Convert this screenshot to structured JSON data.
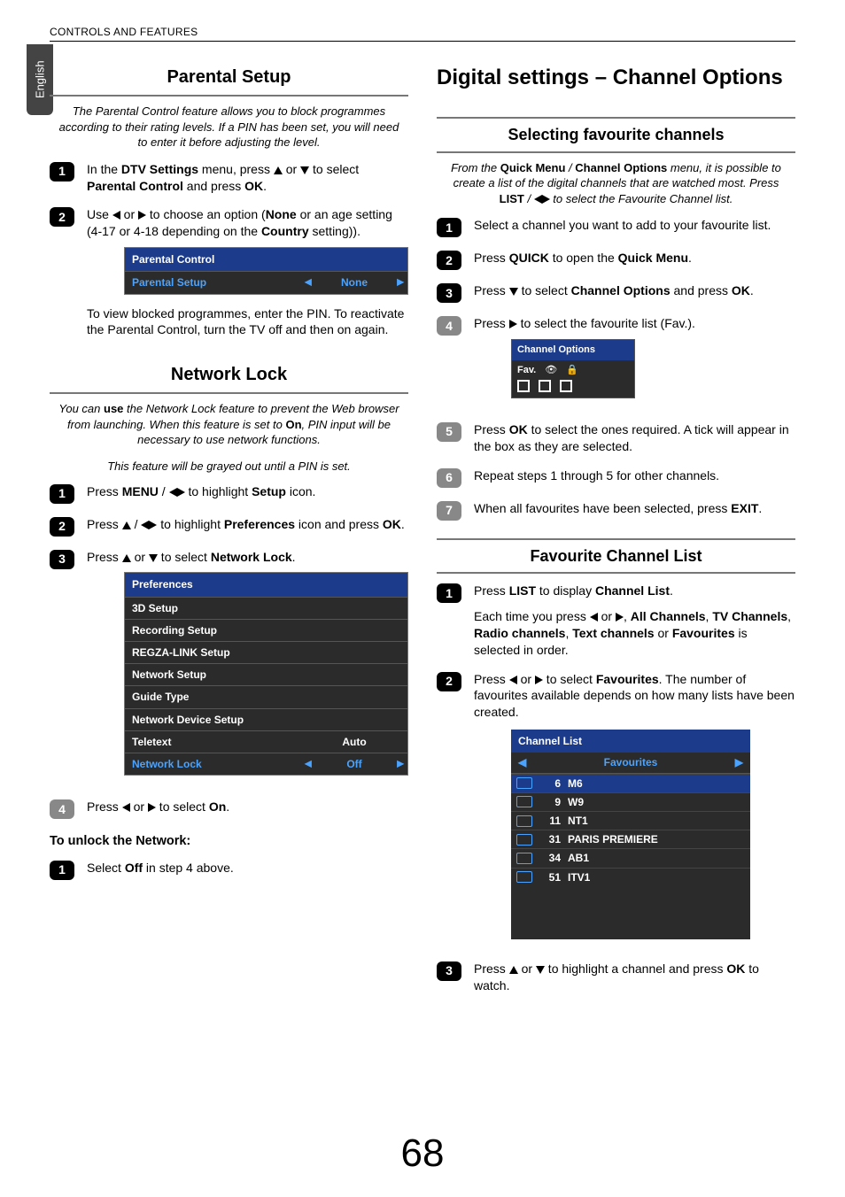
{
  "header": "CONTROLS AND FEATURES",
  "language_tab": "English",
  "page_number": "68",
  "left": {
    "parental": {
      "heading": "Parental Setup",
      "intro": "The Parental Control feature allows you to block programmes according to their rating levels. If a PIN has been set, you will need to enter it before adjusting the level.",
      "step1_a": "In the ",
      "step1_b": "DTV Settings",
      "step1_c": " menu, press ",
      "step1_d": " or ",
      "step1_e": " to select ",
      "step1_f": "Parental Control",
      "step1_g": " and press ",
      "step1_h": "OK",
      "step1_i": ".",
      "step2_a": "Use ",
      "step2_b": " or ",
      "step2_c": " to choose an option (",
      "step2_d": "None",
      "step2_e": " or an age setting (4-17 or 4-18 depending on the ",
      "step2_f": "Country",
      "step2_g": " setting)).",
      "osd_title": "Parental Control",
      "osd_row_label": "Parental Setup",
      "osd_row_value": "None",
      "note": "To view blocked programmes, enter the PIN. To reactivate the Parental Control, turn the TV off and then on again."
    },
    "network": {
      "heading": "Network Lock",
      "intro_a": "You can ",
      "intro_b": "use",
      "intro_c": " the Network Lock feature to prevent the Web browser from launching. When this feature is set to ",
      "intro_d": "On",
      "intro_e": ", PIN input will be necessary to use network functions.",
      "note": "This feature will be grayed out until a PIN is set.",
      "step1_a": "Press ",
      "step1_b": "MENU",
      "step1_c": " / ",
      "step1_d": " to highlight ",
      "step1_e": "Setup",
      "step1_f": " icon.",
      "step2_a": "Press ",
      "step2_b": " / ",
      "step2_c": " to highlight ",
      "step2_d": "Preferences",
      "step2_e": " icon and press ",
      "step2_f": "OK",
      "step2_g": ".",
      "step3_a": "Press ",
      "step3_b": " or ",
      "step3_c": " to select ",
      "step3_d": "Network Lock",
      "step3_e": ".",
      "prefs_title": "Preferences",
      "prefs_rows": [
        "3D Setup",
        "Recording Setup",
        "REGZA-LINK Setup",
        "Network Setup",
        "Guide Type",
        "Network Device Setup"
      ],
      "teletext_label": "Teletext",
      "teletext_value": "Auto",
      "netlock_label": "Network Lock",
      "netlock_value": "Off",
      "step4_a": "Press ",
      "step4_b": " or ",
      "step4_c": " to select ",
      "step4_d": "On",
      "step4_e": ".",
      "unlock_heading": "To unlock the Network:",
      "unlock_step_a": "Select ",
      "unlock_step_b": "Off",
      "unlock_step_c": " in step 4 above."
    }
  },
  "right": {
    "major": "Digital settings – Channel Options",
    "fav": {
      "heading": "Selecting favourite channels",
      "intro_a": "From the ",
      "intro_b": "Quick Menu",
      "intro_c": " / ",
      "intro_d": "Channel Options",
      "intro_e": " menu, it is possible to create a list of the digital channels that are watched most. Press ",
      "intro_f": "LIST",
      "intro_g": " / ",
      "intro_h": " to select the Favourite Channel list.",
      "s1": "Select a channel you want to add to your favourite list.",
      "s2_a": "Press ",
      "s2_b": "QUICK",
      "s2_c": " to open the ",
      "s2_d": "Quick Menu",
      "s2_e": ".",
      "s3_a": "Press ",
      "s3_b": " to select ",
      "s3_c": "Channel Options",
      "s3_d": " and press ",
      "s3_e": "OK",
      "s3_f": ".",
      "s4_a": "Press ",
      "s4_b": " to select the favourite list (Fav.).",
      "chopt_title": "Channel Options",
      "chopt_fav": "Fav.",
      "s5_a": "Press ",
      "s5_b": "OK",
      "s5_c": " to select the ones required. A tick will appear in the box as they are selected.",
      "s6": "Repeat steps 1 through 5 for other channels.",
      "s7_a": "When all favourites have been selected, press ",
      "s7_b": "EXIT",
      "s7_c": "."
    },
    "list": {
      "heading": "Favourite Channel List",
      "s1_a": "Press ",
      "s1_b": "LIST",
      "s1_c": " to display ",
      "s1_d": "Channel List",
      "s1_e": ".",
      "s1_note_a": "Each time you press ",
      "s1_note_b": " or ",
      "s1_note_c": ", ",
      "s1_note_d": "All Channels",
      "s1_note_e": ", ",
      "s1_note_f": "TV Channels",
      "s1_note_g": ", ",
      "s1_note_h": "Radio channels",
      "s1_note_i": ", ",
      "s1_note_j": "Text channels",
      "s1_note_k": " or ",
      "s1_note_l": "Favourites",
      "s1_note_m": " is selected in order.",
      "s2_a": "Press ",
      "s2_b": " or ",
      "s2_c": " to select ",
      "s2_d": "Favourites",
      "s2_e": ". The number of favourites available depends on how many lists have been created.",
      "clist_title": "Channel List",
      "clist_cat": "Favourites",
      "rows": [
        {
          "n": "6",
          "name": "M6"
        },
        {
          "n": "9",
          "name": "W9"
        },
        {
          "n": "11",
          "name": "NT1"
        },
        {
          "n": "31",
          "name": "PARIS PREMIERE"
        },
        {
          "n": "34",
          "name": "AB1"
        },
        {
          "n": "51",
          "name": "ITV1"
        }
      ],
      "s3_a": "Press ",
      "s3_b": " or ",
      "s3_c": " to highlight a channel and press ",
      "s3_d": "OK",
      "s3_e": " to watch."
    }
  }
}
